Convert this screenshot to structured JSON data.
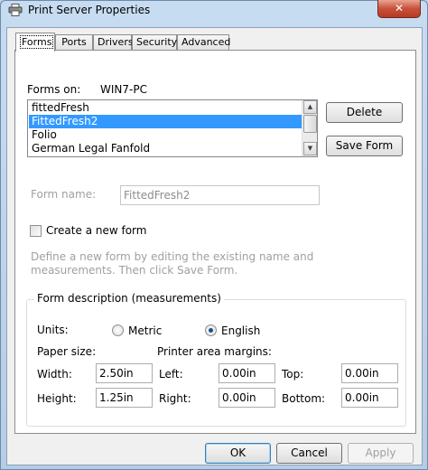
{
  "window": {
    "title": "Print Server Properties",
    "close_glyph": "✕",
    "icon": "printer-icon"
  },
  "tabs": [
    {
      "label": "Forms",
      "active": true
    },
    {
      "label": "Ports"
    },
    {
      "label": "Drivers"
    },
    {
      "label": "Security"
    },
    {
      "label": "Advanced"
    }
  ],
  "forms": {
    "forms_on_label": "Forms on:",
    "server_name": "WIN7-PC",
    "list": [
      "fittedFresh",
      "FittedFresh2",
      "Folio",
      "German Legal Fanfold"
    ],
    "selected_index": 1,
    "delete_label": "Delete",
    "save_label": "Save Form",
    "form_name_label": "Form name:",
    "form_name_value": "FittedFresh2",
    "create_new_label": "Create a new form",
    "create_new_checked": false,
    "help_line1": "Define a new form by editing the existing name and",
    "help_line2": "measurements. Then click Save Form."
  },
  "description": {
    "group_title": "Form description (measurements)",
    "units_label": "Units:",
    "metric_label": "Metric",
    "english_label": "English",
    "selected_unit": "English",
    "paper_size_label": "Paper size:",
    "margins_label": "Printer area margins:",
    "width_label": "Width:",
    "width_value": "2.50in",
    "height_label": "Height:",
    "height_value": "1.25in",
    "left_label": "Left:",
    "left_value": "0.00in",
    "right_label": "Right:",
    "right_value": "0.00in",
    "top_label": "Top:",
    "top_value": "0.00in",
    "bottom_label": "Bottom:",
    "bottom_value": "0.00in"
  },
  "footer": {
    "ok_label": "OK",
    "cancel_label": "Cancel",
    "apply_label": "Apply"
  }
}
